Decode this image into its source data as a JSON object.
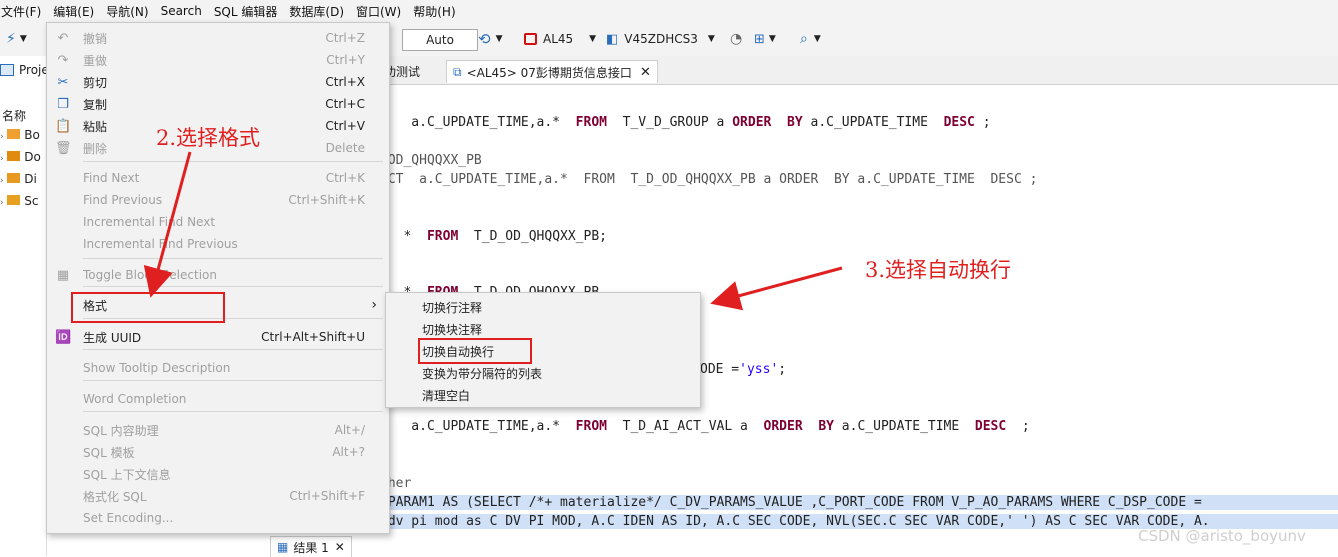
{
  "menubar": [
    "文件(F)",
    "编辑(E)",
    "导航(N)",
    "Search",
    "SQL 编辑器",
    "数据库(D)",
    "窗口(W)",
    "帮助(H)"
  ],
  "toolbar": {
    "auto": "Auto",
    "connection": "AL45",
    "schema": "V45ZDHCS3"
  },
  "left_panel": {
    "project_tab": "Proje",
    "name_header": "名称",
    "tree": [
      "Bo",
      "Do",
      "Di",
      "Sc"
    ]
  },
  "tabs": {
    "tab1": "功测试",
    "tab2": "<AL45> 07彭博期货信息接口"
  },
  "editor_lines": [
    {
      "pre": "T   a.C_UPDATE_TIME,a.*  ",
      "kw1": "FROM",
      "mid": "  T_V_D_GROUP a ",
      "kw2": "ORDER",
      "mid2": "  ",
      "kw3": "BY",
      "post": " a.C_UPDATE_TIME  ",
      "kw4": "DESC",
      "end": " ;"
    },
    {
      "text": "_OD_QHQQXX_PB"
    },
    {
      "text": "ECT  a.C_UPDATE_TIME,a.*  FROM  T_D_OD_QHQQXX_PB a ORDER  BY a.C_UPDATE_TIME  DESC ;"
    },
    {
      "pre": "T  *  ",
      "kw1": "FROM",
      "post": "  T_D_OD_QHQQXX_PB;"
    },
    {
      "pre": "T  *  ",
      "kw1": "FROM",
      "post": "  T_D_OD_QHQQXX_PB"
    },
    {
      "pre": "ODE =",
      "str": "'yss'",
      "post": ";"
    },
    {
      "pre": "T   a.C_UPDATE_TIME,a.*  ",
      "kw1": "FROM",
      "mid": "  T_D_AI_ACT_VAL a  ",
      "kw2": "ORDER",
      "mid2": "  ",
      "kw3": "BY",
      "post": " a.C_UPDATE_TIME  ",
      "kw4": "DESC",
      "end": "  ;"
    },
    {
      "text": "cher"
    },
    {
      "text": " PARAM1 AS (SELECT /*+ materialize*/ C_DV_PARAMS_VALUE ,C_PORT_CODE FROM V_P_AO_PARAMS WHERE C_DSP_CODE ="
    },
    {
      "text": " dv pi mod as C DV PI MOD, A.C IDEN AS ID, A.C SEC CODE, NVL(SEC.C SEC VAR CODE,' ') AS C SEC VAR CODE, A."
    }
  ],
  "context_menu": [
    {
      "label": "撤销",
      "shortcut": "Ctrl+Z",
      "disabled": true,
      "icon": "undo-icon",
      "glyph": "↶"
    },
    {
      "label": "重做",
      "shortcut": "Ctrl+Y",
      "disabled": true,
      "icon": "redo-icon",
      "glyph": "↷"
    },
    {
      "label": "剪切",
      "shortcut": "Ctrl+X",
      "disabled": false,
      "icon": "scissors-icon",
      "glyph": "✂"
    },
    {
      "label": "复制",
      "shortcut": "Ctrl+C",
      "disabled": false,
      "icon": "copy-icon",
      "glyph": "❐"
    },
    {
      "label": "粘贴",
      "shortcut": "Ctrl+V",
      "disabled": false,
      "icon": "paste-icon",
      "glyph": "📋"
    },
    {
      "label": "删除",
      "shortcut": "Delete",
      "disabled": true,
      "icon": "trash-icon",
      "glyph": "🗑"
    },
    {
      "label": "Find Next",
      "shortcut": "Ctrl+K",
      "disabled": true,
      "icon": "",
      "glyph": ""
    },
    {
      "label": "Find Previous",
      "shortcut": "Ctrl+Shift+K",
      "disabled": true,
      "icon": "",
      "glyph": ""
    },
    {
      "label": "Incremental Find Next",
      "shortcut": "",
      "disabled": true,
      "icon": "",
      "glyph": ""
    },
    {
      "label": "Incremental Find Previous",
      "shortcut": "",
      "disabled": true,
      "icon": "",
      "glyph": ""
    },
    {
      "label": "Toggle Block Selection",
      "shortcut": "",
      "disabled": true,
      "icon": "block-selection-icon",
      "glyph": "▦"
    },
    {
      "label": "格式",
      "shortcut": "›",
      "disabled": false,
      "icon": "",
      "glyph": ""
    },
    {
      "label": "生成 UUID",
      "shortcut": "Ctrl+Alt+Shift+U",
      "disabled": false,
      "icon": "uuid-icon",
      "glyph": "🆔"
    },
    {
      "label": "Show Tooltip Description",
      "shortcut": "",
      "disabled": true,
      "icon": "",
      "glyph": ""
    },
    {
      "label": "Word Completion",
      "shortcut": "",
      "disabled": true,
      "icon": "",
      "glyph": ""
    },
    {
      "label": "SQL 内容助理",
      "shortcut": "Alt+/",
      "disabled": true,
      "icon": "",
      "glyph": ""
    },
    {
      "label": "SQL 模板",
      "shortcut": "Alt+?",
      "disabled": true,
      "icon": "",
      "glyph": ""
    },
    {
      "label": "SQL 上下文信息",
      "shortcut": "",
      "disabled": true,
      "icon": "",
      "glyph": ""
    },
    {
      "label": "格式化 SQL",
      "shortcut": "Ctrl+Shift+F",
      "disabled": true,
      "icon": "",
      "glyph": ""
    },
    {
      "label": "Set Encoding...",
      "shortcut": "",
      "disabled": true,
      "icon": "",
      "glyph": ""
    }
  ],
  "submenu": [
    "切换行注释",
    "切换块注释",
    "切换自动换行",
    "变换为带分隔符的列表",
    "清理空白"
  ],
  "annotations": {
    "step2": "2.选择格式",
    "step3": "3.选择自动换行"
  },
  "bottom_tab": "结果 1",
  "watermark": "CSDN @aristo_boyunv",
  "colors": {
    "annotation": "#e02020",
    "keyword": "#7f0033",
    "string": "#2a00ff"
  }
}
